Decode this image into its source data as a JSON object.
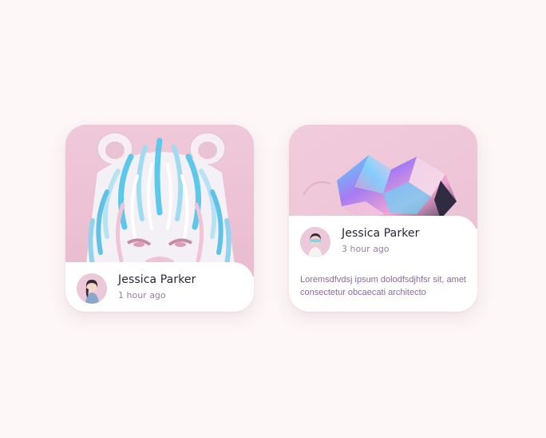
{
  "cards": [
    {
      "author": "Jessica Parker",
      "time": "1 hour ago",
      "image": "tiger-feather-art"
    },
    {
      "author": "Jessica Parker",
      "time": "3 hour ago",
      "image": "iridescent-crumpled-sculpture",
      "description": "Loremsdfvdsj ipsum dolodfsdjhfsr sit, amet consectetur obcaecati architecto"
    }
  ],
  "colors": {
    "background": "#fdf7f7",
    "card": "#ffffff",
    "art_pink": "#ecc6d8",
    "name": "#2a2438",
    "meta": "#9a7fa4"
  }
}
